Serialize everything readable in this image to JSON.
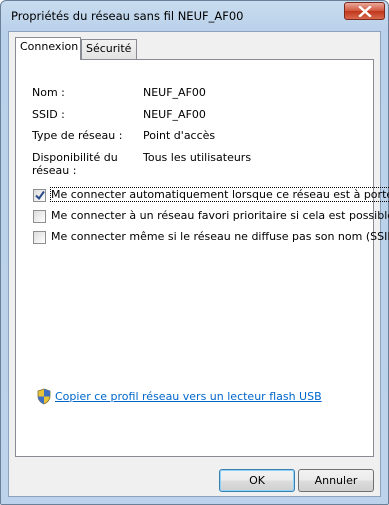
{
  "window": {
    "title": "Propriétés du réseau sans fil NEUF_AF00"
  },
  "tabs": [
    {
      "label": "Connexion",
      "active": true
    },
    {
      "label": "Sécurité",
      "active": false
    }
  ],
  "properties": [
    {
      "label": "Nom :",
      "value": "NEUF_AF00"
    },
    {
      "label": "SSID :",
      "value": "NEUF_AF00"
    },
    {
      "label": "Type de réseau :",
      "value": "Point d'accès"
    },
    {
      "label": "Disponibilité du réseau :",
      "value": "Tous les utilisateurs"
    }
  ],
  "checkboxes": [
    {
      "label": "Me connecter automatiquement lorsque ce réseau est à portée",
      "checked": true
    },
    {
      "label": "Me connecter à un réseau favori prioritaire si cela est possible",
      "checked": false
    },
    {
      "label": "Me connecter même si le réseau ne diffuse pas son nom (SSID)",
      "checked": false
    }
  ],
  "link": {
    "text": "Copier ce profil réseau vers un lecteur flash USB",
    "icon": "shield-icon"
  },
  "buttons": {
    "ok": "OK",
    "cancel": "Annuler"
  },
  "colors": {
    "link": "#0066cc",
    "close": "#c0381c",
    "frame": "#b9d1ea"
  }
}
